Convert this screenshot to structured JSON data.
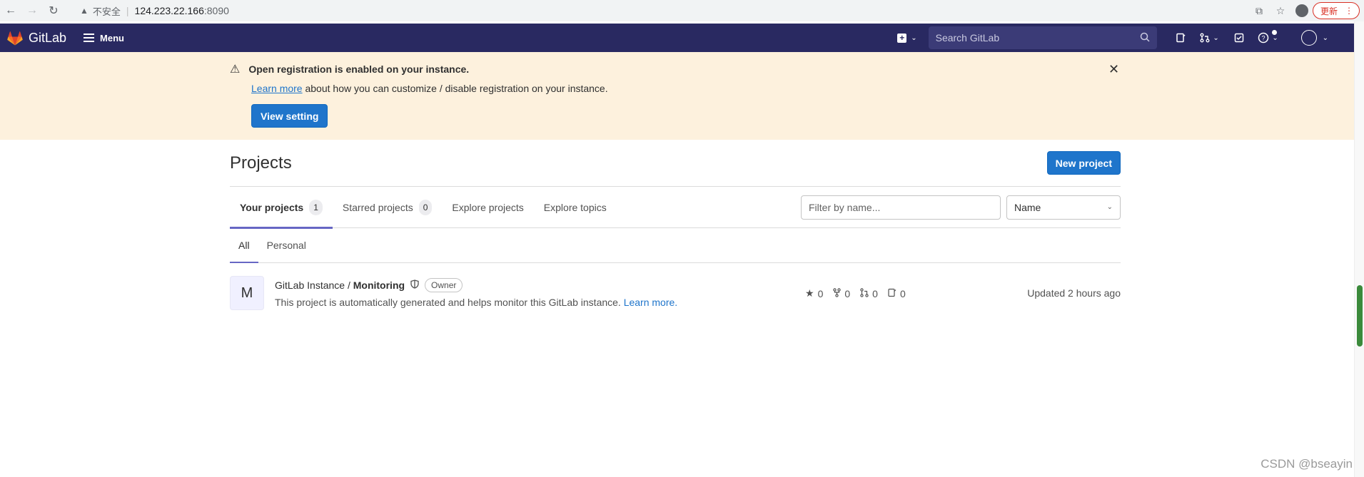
{
  "browser": {
    "insecure_label": "不安全",
    "url_host": "124.223.22.166",
    "url_port": ":8090",
    "update_label": "更新"
  },
  "header": {
    "logo_text": "GitLab",
    "menu_label": "Menu",
    "search_placeholder": "Search GitLab"
  },
  "banner": {
    "title": "Open registration is enabled on your instance.",
    "link_text": "Learn more",
    "text": " about how you can customize / disable registration on your instance.",
    "button_label": "View setting"
  },
  "page": {
    "title": "Projects",
    "new_project_label": "New project"
  },
  "tabs": [
    {
      "label": "Your projects",
      "count": "1",
      "active": true
    },
    {
      "label": "Starred projects",
      "count": "0",
      "active": false
    },
    {
      "label": "Explore projects",
      "active": false
    },
    {
      "label": "Explore topics",
      "active": false
    }
  ],
  "filters": {
    "filter_placeholder": "Filter by name...",
    "sort_value": "Name"
  },
  "subtabs": [
    {
      "label": "All",
      "active": true
    },
    {
      "label": "Personal",
      "active": false
    }
  ],
  "project": {
    "avatar_letter": "M",
    "namespace": "GitLab Instance / ",
    "name": "Monitoring",
    "role": "Owner",
    "description": "This project is automatically generated and helps monitor this GitLab instance. ",
    "learn_more": "Learn more.",
    "stars": "0",
    "forks": "0",
    "merge_requests": "0",
    "issues": "0",
    "updated": "Updated 2 hours ago"
  },
  "watermark": "CSDN @bseayin",
  "colors": {
    "header_bg": "#292961",
    "banner_bg": "#fdf1dd",
    "primary": "#1f75cb",
    "tab_active": "#6666c4"
  }
}
